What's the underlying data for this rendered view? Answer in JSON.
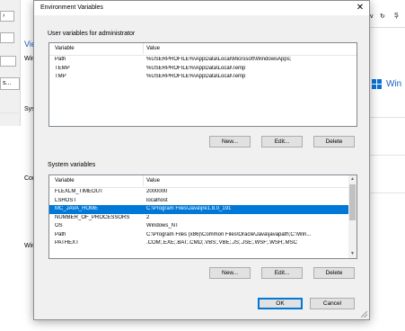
{
  "background": {
    "partial_labels": [
      "Vie",
      "Win",
      "Sys",
      "Cor",
      "Win"
    ],
    "top_right_controls": [
      "v",
      "↻",
      "Ş"
    ],
    "windows_brand_text": "Win",
    "left_button_fragment": "s..."
  },
  "dialog": {
    "title": "Environment Variables",
    "close_symbol": "✕",
    "user_section": {
      "label": "User variables for administrator",
      "columns": [
        "Variable",
        "Value"
      ],
      "rows": [
        {
          "variable": "Path",
          "value": "%USERPROFILE%\\AppData\\Local\\Microsoft\\WindowsApps;"
        },
        {
          "variable": "TEMP",
          "value": "%USERPROFILE%\\AppData\\Local\\Temp"
        },
        {
          "variable": "TMP",
          "value": "%USERPROFILE%\\AppData\\Local\\Temp"
        }
      ],
      "buttons": {
        "new": "New...",
        "edit": "Edit...",
        "delete": "Delete"
      }
    },
    "system_section": {
      "label": "System variables",
      "columns": [
        "Variable",
        "Value"
      ],
      "rows": [
        {
          "variable": "FLEXLM_TIMEOUT",
          "value": "2000000"
        },
        {
          "variable": "LSHOST",
          "value": "localhost"
        },
        {
          "variable": "MC_JAVA_HOME",
          "value": "C:\\Program Files\\Java\\jre1.8.0_191",
          "selected": true
        },
        {
          "variable": "NUMBER_OF_PROCESSORS",
          "value": "2"
        },
        {
          "variable": "OS",
          "value": "Windows_NT"
        },
        {
          "variable": "Path",
          "value": "C:\\Program Files (x86)\\Common Files\\Oracle\\Java\\javapath;C:\\Win..."
        },
        {
          "variable": "PATHEXT",
          "value": ".COM;.EXE;.BAT;.CMD;.VBS;.VBE;.JS;.JSE;.WSF;.WSH;.MSC"
        }
      ],
      "buttons": {
        "new": "New...",
        "edit": "Edit...",
        "delete": "Delete"
      }
    },
    "footer_buttons": {
      "ok": "OK",
      "cancel": "Cancel"
    },
    "colors": {
      "selection": "#0078d7",
      "dialog_bg": "#f0f0f0",
      "accent_text": "#1c5ec4"
    }
  }
}
